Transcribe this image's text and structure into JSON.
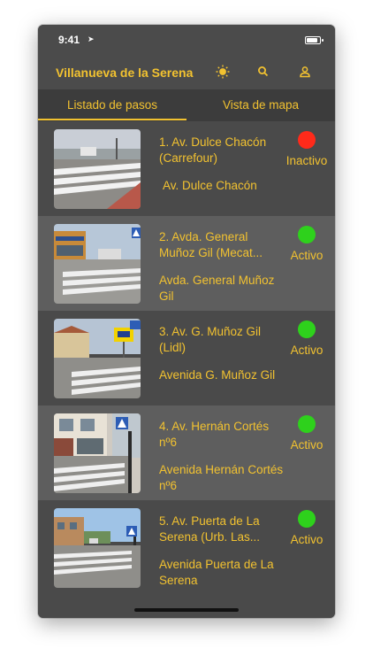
{
  "status_bar": {
    "time": "9:41"
  },
  "navbar": {
    "title": "Villanueva de la Serena",
    "icons": [
      "sun-icon",
      "search-icon",
      "user-icon"
    ]
  },
  "tabs": {
    "list": "Listado de pasos",
    "map": "Vista de mapa"
  },
  "colors": {
    "accent": "#f2c230",
    "inactive": "#ff2a1a",
    "active": "#2ed11c"
  },
  "items": [
    {
      "title": "1. Av. Dulce Chacón (Carrefour)",
      "street": "Av. Dulce Chacón",
      "status": "Inactivo",
      "status_color": "#ff2a1a"
    },
    {
      "title": "2. Avda. General Muñoz Gil (Mecat...",
      "street": "Avda. General Muñoz Gil",
      "status": "Activo",
      "status_color": "#2ed11c"
    },
    {
      "title": "3. Av. G. Muñoz Gil (Lidl)",
      "street": "Avenida G. Muñoz Gil",
      "status": "Activo",
      "status_color": "#2ed11c"
    },
    {
      "title": "4. Av. Hernán Cortés nº6",
      "street": "Avenida Hernán Cortés nº6",
      "status": "Activo",
      "status_color": "#2ed11c"
    },
    {
      "title": "5. Av. Puerta de La Serena (Urb. Las...",
      "street": "Avenida Puerta de La Serena",
      "status": "Activo",
      "status_color": "#2ed11c"
    }
  ]
}
